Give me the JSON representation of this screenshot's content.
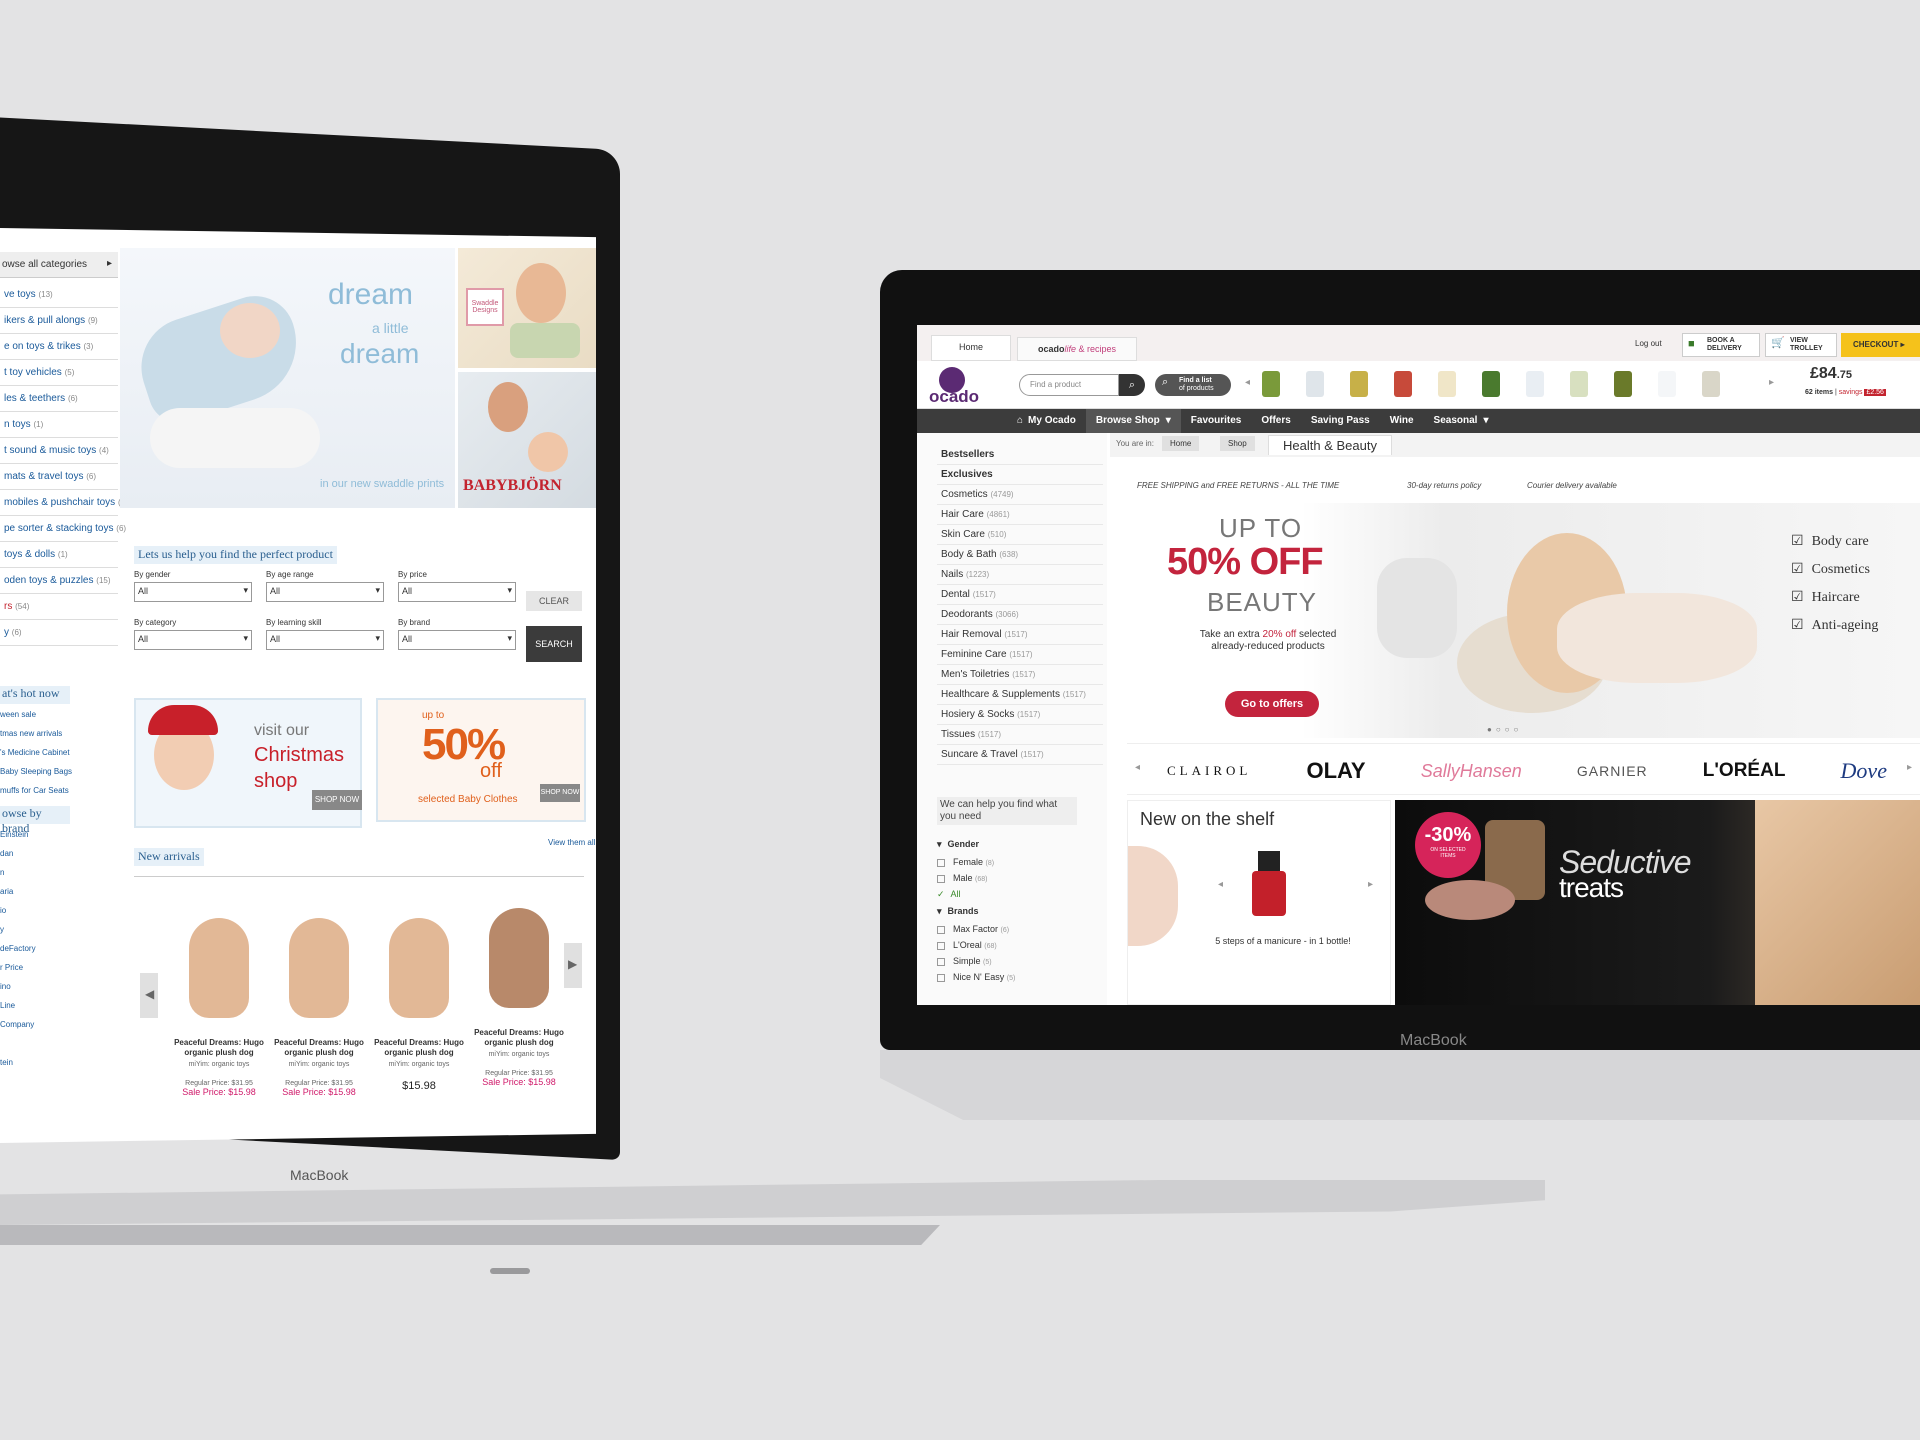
{
  "left_laptop": {
    "brand": "MacBook",
    "sidebar": {
      "browse_label": "owse all categories",
      "categories": [
        {
          "label": "ve toys",
          "count": "(13)"
        },
        {
          "label": "ikers & pull alongs",
          "count": "(9)"
        },
        {
          "label": "e on toys & trikes",
          "count": "(3)"
        },
        {
          "label": "t toy vehicles",
          "count": "(5)"
        },
        {
          "label": "les & teethers",
          "count": "(6)"
        },
        {
          "label": "n toys",
          "count": "(1)"
        },
        {
          "label": "t sound & music toys",
          "count": "(4)"
        },
        {
          "label": "mats & travel toys",
          "count": "(6)"
        },
        {
          "label": "mobiles & pushchair toys",
          "count": "(1)"
        },
        {
          "label": "pe sorter & stacking toys",
          "count": "(6)"
        },
        {
          "label": "toys & dolls",
          "count": "(1)"
        },
        {
          "label": "oden toys & puzzles",
          "count": "(15)"
        },
        {
          "label": "rs",
          "count": "(54)"
        },
        {
          "label": "y",
          "count": "(6)"
        }
      ],
      "hot_now_title": "at's hot now",
      "hot_now_items": [
        "ween sale",
        "tmas new arrivals",
        "'s Medicine Cabinet",
        "Baby Sleeping Bags",
        "muffs for Car Seats"
      ],
      "brand_title": "owse by brand",
      "brands": [
        "Einstein",
        "dan",
        "n",
        "aria",
        "io",
        "y",
        "deFactory",
        "r Price",
        "ino",
        "Line",
        "Company",
        "",
        "tein"
      ]
    },
    "hero": {
      "line1": "dream",
      "line2": "a little",
      "line3": "dream",
      "line4": "in our new swaddle prints",
      "logo1": "Swaddle Designs",
      "logo2": "BABYBJÖRN"
    },
    "finder": {
      "title": "Lets us help you find the perfect product",
      "fields": [
        {
          "label": "By gender",
          "value": "All"
        },
        {
          "label": "By age range",
          "value": "All"
        },
        {
          "label": "By price",
          "value": "All"
        },
        {
          "label": "By category",
          "value": "All"
        },
        {
          "label": "By learning skill",
          "value": "All"
        },
        {
          "label": "By brand",
          "value": "All"
        }
      ],
      "clear": "CLEAR",
      "search": "SEARCH"
    },
    "promo1": {
      "a": "visit our",
      "b": "Christmas",
      "c": "shop",
      "btn": "SHOP NOW"
    },
    "promo2": {
      "a": "up to",
      "b": "50%",
      "c": "off",
      "d": "selected Baby Clothes",
      "btn": "SHOP NOW"
    },
    "new_arrivals": {
      "title": "New arrivals",
      "view_all": "View them all",
      "products": [
        {
          "name": "Peaceful Dreams: Hugo organic plush dog",
          "brand": "miYim: organic toys",
          "regular": "Regular Price: $31.95",
          "sale": "Sale Price: $15.98"
        },
        {
          "name": "Peaceful Dreams: Hugo organic plush dog",
          "brand": "miYim: organic toys",
          "regular": "Regular Price: $31.95",
          "sale": "Sale Price: $15.98"
        },
        {
          "name": "Peaceful Dreams: Hugo organic plush dog",
          "brand": "miYim: organic toys",
          "regular": "",
          "sale": "$15.98"
        },
        {
          "name": "Peaceful Dreams: Hugo organic plush dog",
          "brand": "miYim: organic toys",
          "regular": "Regular Price: $31.95",
          "sale": "Sale Price: $15.98"
        }
      ]
    }
  },
  "right_laptop": {
    "brand": "MacBook",
    "tabs": {
      "home": "Home",
      "recipes_a": "ocado",
      "recipes_b": "life",
      "recipes_c": "& recipes"
    },
    "top": {
      "logout": "Log out",
      "book": "BOOK A DELIVERY",
      "view": "VIEW TROLLEY",
      "checkout": "CHECKOUT"
    },
    "logo": "ocado",
    "search": {
      "placeholder": "Find a product",
      "find_list": "Find a list",
      "find_list_sub": "of products"
    },
    "trolley": {
      "total_main": "£84",
      "total_dec": ".75",
      "items": "62 items",
      "savings_label": "savings",
      "savings": "£2.56"
    },
    "nav": [
      "My Ocado",
      "Browse Shop",
      "Favourites",
      "Offers",
      "Saving Pass",
      "Wine",
      "Seasonal"
    ],
    "breadcrumb": {
      "label": "You are in:",
      "home": "Home",
      "shop": "Shop",
      "current": "Health & Beauty"
    },
    "categories": [
      {
        "label": "Bestsellers",
        "count": "",
        "bold": true
      },
      {
        "label": "Exclusives",
        "count": "",
        "bold": true
      },
      {
        "label": "Cosmetics",
        "count": "(4749)"
      },
      {
        "label": "Hair Care",
        "count": "(4861)"
      },
      {
        "label": "Skin Care",
        "count": "(510)"
      },
      {
        "label": "Body & Bath",
        "count": "(638)"
      },
      {
        "label": "Nails",
        "count": "(1223)"
      },
      {
        "label": "Dental",
        "count": "(1517)"
      },
      {
        "label": "Deodorants",
        "count": "(3066)"
      },
      {
        "label": "Hair Removal",
        "count": "(1517)"
      },
      {
        "label": "Feminine Care",
        "count": "(1517)"
      },
      {
        "label": "Men's Toiletries",
        "count": "(1517)"
      },
      {
        "label": "Healthcare & Supplements",
        "count": "(1517)"
      },
      {
        "label": "Hosiery & Socks",
        "count": "(1517)"
      },
      {
        "label": "Tissues",
        "count": "(1517)"
      },
      {
        "label": "Suncare & Travel",
        "count": "(1517)"
      }
    ],
    "help": {
      "title": "We can help you find what you need",
      "gender": "Gender",
      "gender_opts": [
        {
          "label": "Female",
          "count": "(8)"
        },
        {
          "label": "Male",
          "count": "(68)"
        },
        {
          "label": "All",
          "count": ""
        }
      ],
      "brands": "Brands",
      "brand_opts": [
        {
          "label": "Max Factor",
          "count": "(6)"
        },
        {
          "label": "L'Oreal",
          "count": "(68)"
        },
        {
          "label": "Simple",
          "count": "(5)"
        },
        {
          "label": "Nice N' Easy",
          "count": "(5)"
        }
      ]
    },
    "info_bar": [
      "FREE SHIPPING and FREE RETURNS - ALL THE TIME",
      "30-day returns policy",
      "Courier delivery available"
    ],
    "hero": {
      "up_to": "UP TO",
      "percent": "50% OFF",
      "beauty": "BEAUTY",
      "sub1": "Take an extra",
      "sub_pct": "20% off",
      "sub2": "selected already-reduced products",
      "button": "Go to offers",
      "checks": [
        "Body care",
        "Cosmetics",
        "Haircare",
        "Anti-ageing"
      ]
    },
    "brands": [
      "CLAIROL",
      "OLAY",
      "SallyHansen",
      "GARNIER",
      "L'ORÉAL",
      "Dove"
    ],
    "shelf": {
      "title": "New on the shelf",
      "caption": "5 steps of a manicure - in 1 bottle!"
    },
    "seductive": {
      "pct": "-30%",
      "on": "ON SELECTED ITEMS",
      "line1": "Seductive",
      "line2": "treats"
    }
  }
}
